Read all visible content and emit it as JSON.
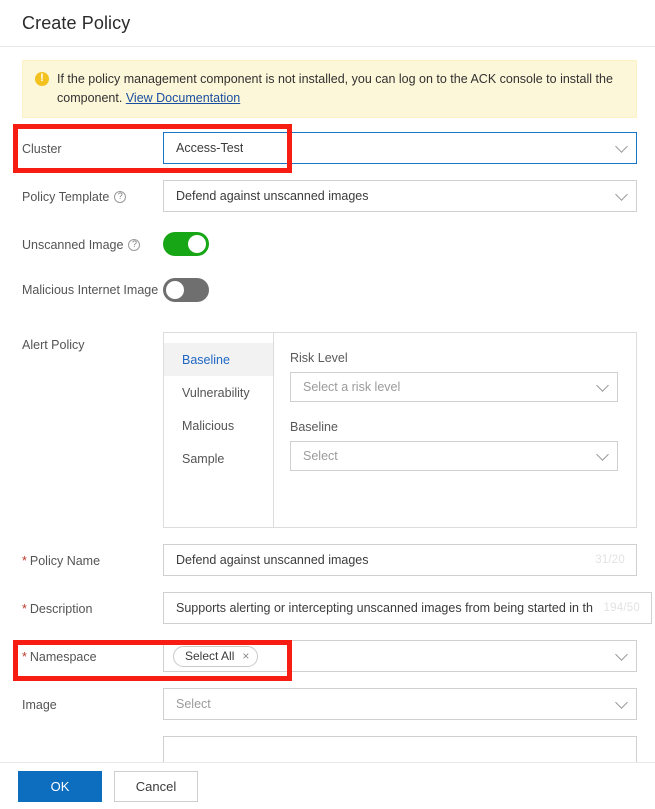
{
  "header": {
    "title": "Create Policy"
  },
  "banner": {
    "icon": "warning-icon",
    "text": "If the policy management component is not installed, you can log on to the ACK console to install the component.",
    "link_label": "View Documentation"
  },
  "form": {
    "cluster": {
      "label": "Cluster",
      "value": "Access-Test"
    },
    "policy_template": {
      "label": "Policy Template",
      "value": "Defend against unscanned images"
    },
    "unscanned_image": {
      "label": "Unscanned Image",
      "state": "on"
    },
    "malicious_internet_image": {
      "label": "Malicious Internet Image",
      "state": "off"
    },
    "alert_policy": {
      "label": "Alert Policy",
      "tabs": [
        {
          "label": "Baseline",
          "active": true
        },
        {
          "label": "Vulnerability",
          "active": false
        },
        {
          "label": "Malicious",
          "active": false
        },
        {
          "label": "Sample",
          "active": false
        }
      ],
      "risk_level": {
        "label": "Risk Level",
        "placeholder": "Select a risk level"
      },
      "baseline": {
        "label": "Baseline",
        "placeholder": "Select"
      }
    },
    "policy_name": {
      "label": "Policy Name",
      "required": "*",
      "value": "Defend against unscanned images",
      "counter": "31/20"
    },
    "description": {
      "label": "Description",
      "required": "*",
      "value": "Supports alerting or intercepting unscanned images from being started in th",
      "counter": "194/50"
    },
    "namespace": {
      "label": "Namespace",
      "required": "*",
      "tag_label": "Select All",
      "tag_close": "×"
    },
    "image": {
      "label": "Image",
      "placeholder": "Select"
    }
  },
  "footer": {
    "ok_label": "OK",
    "cancel_label": "Cancel"
  },
  "colors": {
    "accent": "#0d6ebf",
    "toggle_on": "#16a616",
    "toggle_off": "#6f6f6f",
    "banner_bg": "#fdf7da",
    "annotation": "#f81d13",
    "tab_active_text": "#2068c4"
  }
}
